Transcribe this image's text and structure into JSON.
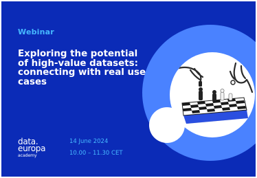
{
  "banner": {
    "badge": "Webinar",
    "title": "Exploring the potential of high-value datasets: connecting with real use cases",
    "date": "14 June 2024",
    "time": "10.00 – 11.30 CET",
    "logo": {
      "line1": "data.",
      "line2": "europa",
      "line3": "academy"
    }
  },
  "colors": {
    "background": "#0b2bb7",
    "accent": "#46b8ff",
    "circle": "#4a82ff",
    "text": "#ffffff"
  },
  "illustration": {
    "icon": "chess-hands-icon"
  }
}
